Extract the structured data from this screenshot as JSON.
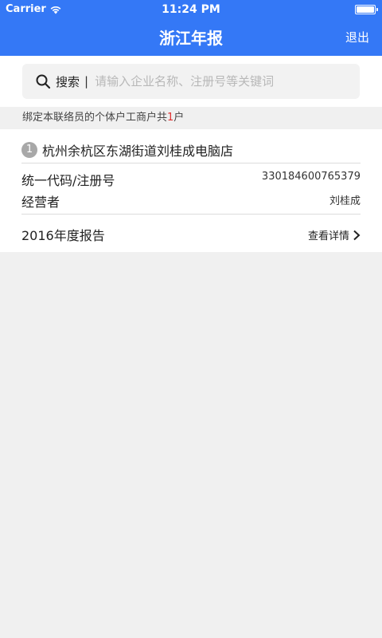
{
  "status_bar": {
    "carrier": "Carrier",
    "time": "11:24 PM"
  },
  "nav": {
    "title": "浙江年报",
    "logout": "退出"
  },
  "search": {
    "label": "搜索",
    "separator": "|",
    "placeholder": "请输入企业名称、注册号等关键词"
  },
  "summary": {
    "prefix": "绑定本联络员的个体户工商户共",
    "count": "1",
    "suffix": "户"
  },
  "card": {
    "index": "1",
    "name": "杭州余杭区东湖街道刘桂成电脑店",
    "code_label": "统一代码/注册号",
    "code_value": "330184600765379",
    "operator_label": "经营者",
    "operator_value": "刘桂成",
    "report_label": "2016年度报告",
    "report_link": "查看详情"
  },
  "colors": {
    "header_bg": "#3478f6",
    "count_red": "#e03030",
    "badge_gray": "#a8a8a8"
  }
}
